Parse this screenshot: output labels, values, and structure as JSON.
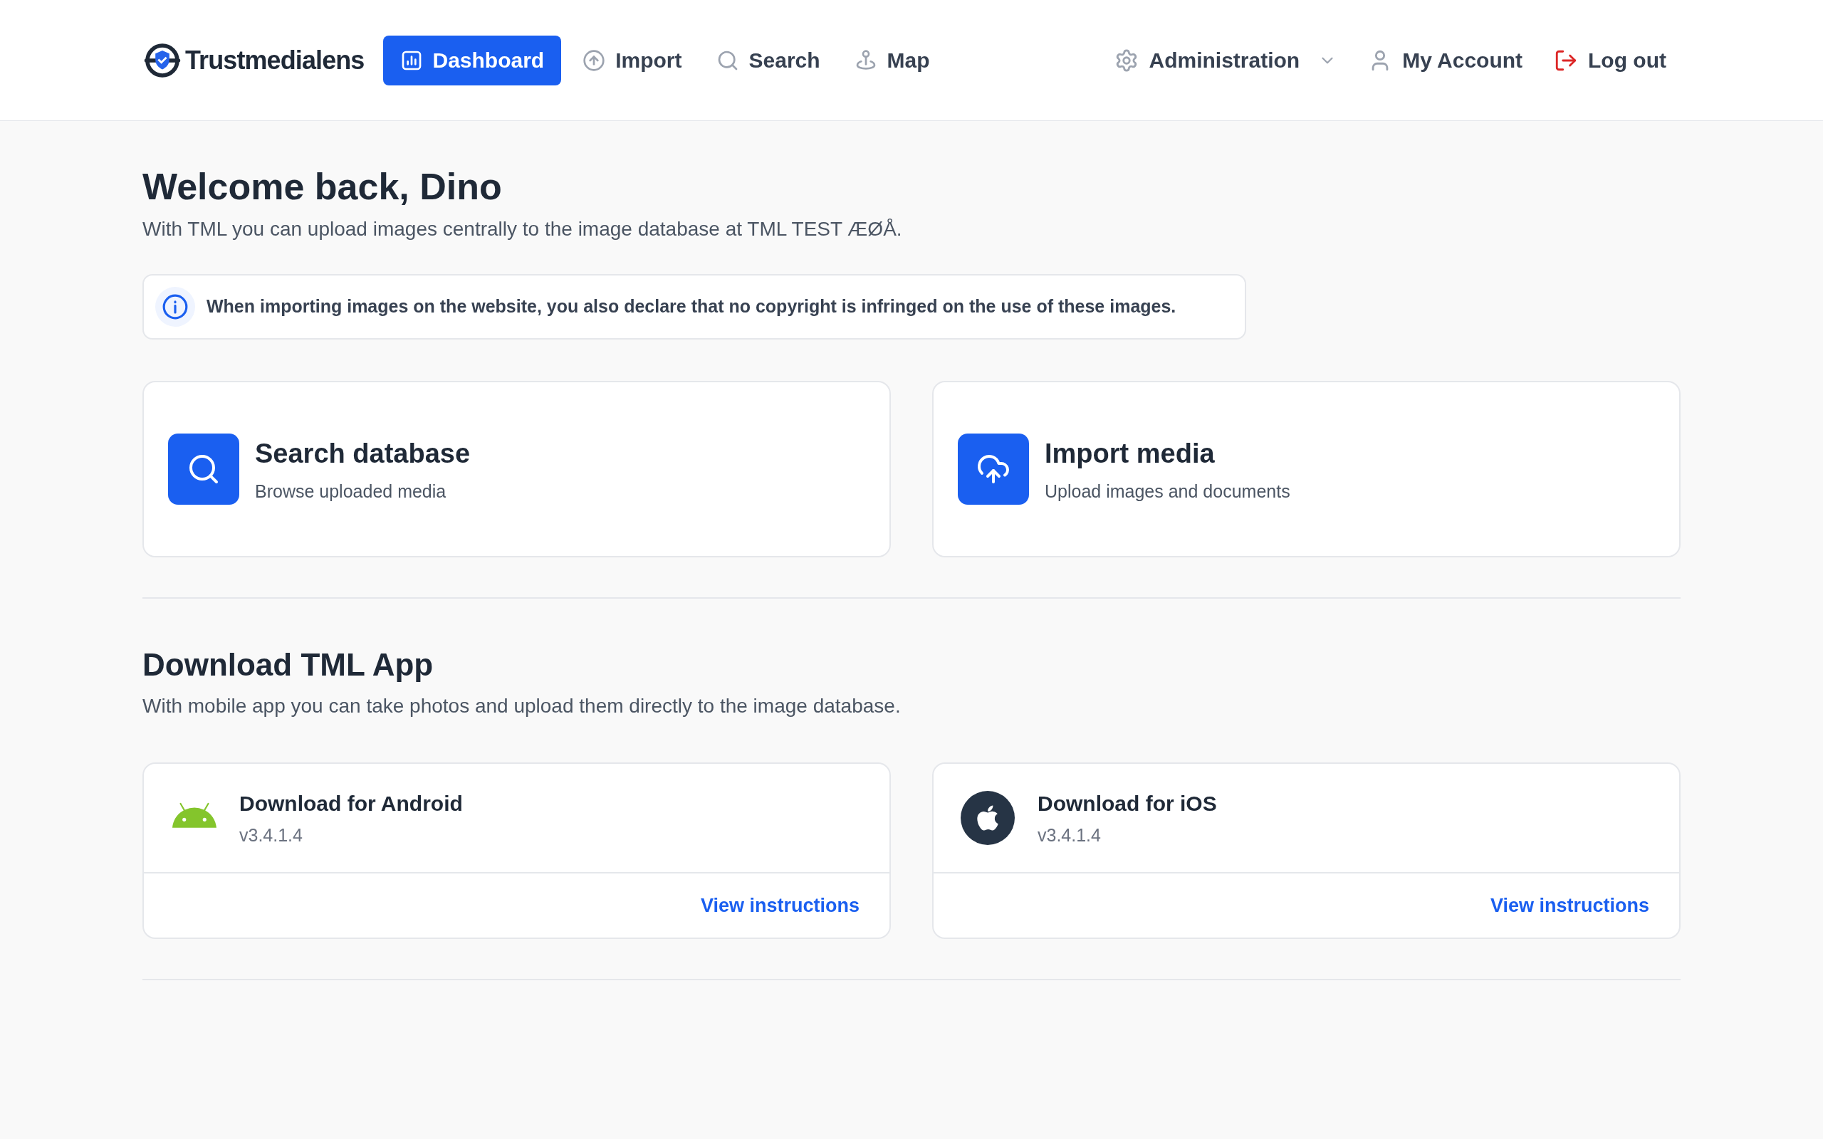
{
  "header": {
    "logo": "Trustmedialens",
    "nav": [
      {
        "kind": "dashboard",
        "label": "Dashboard",
        "selected": true
      },
      {
        "kind": "import",
        "label": "Import",
        "selected": false
      },
      {
        "kind": "search",
        "label": "Search",
        "selected": false
      },
      {
        "kind": "map",
        "label": "Map",
        "selected": false
      }
    ],
    "right_nav": [
      {
        "kind": "admin",
        "label": "Administration"
      },
      {
        "kind": "account",
        "label": "My Account"
      },
      {
        "kind": "logout",
        "label": "Log out"
      }
    ]
  },
  "welcome": {
    "title": "Welcome back, Dino",
    "subtitle": "With TML you can upload images centrally to the image database at TML TEST ÆØÅ."
  },
  "notice": "When importing images on the website, you also declare that no copyright is infringed on the use of these images.",
  "actions": [
    {
      "kind": "search",
      "title": "Search database",
      "subtitle": "Browse uploaded media"
    },
    {
      "kind": "import",
      "title": "Import media",
      "subtitle": "Upload images and documents"
    }
  ],
  "app_section": {
    "title": "Download TML App",
    "subtitle": "With mobile app you can take photos and upload them directly to the image database.",
    "downloads": [
      {
        "kind": "android",
        "title": "Download for Android",
        "version": "v3.4.1.4",
        "link": "View instructions"
      },
      {
        "kind": "ios",
        "title": "Download for iOS",
        "version": "v3.4.1.4",
        "link": "View instructions"
      }
    ]
  }
}
